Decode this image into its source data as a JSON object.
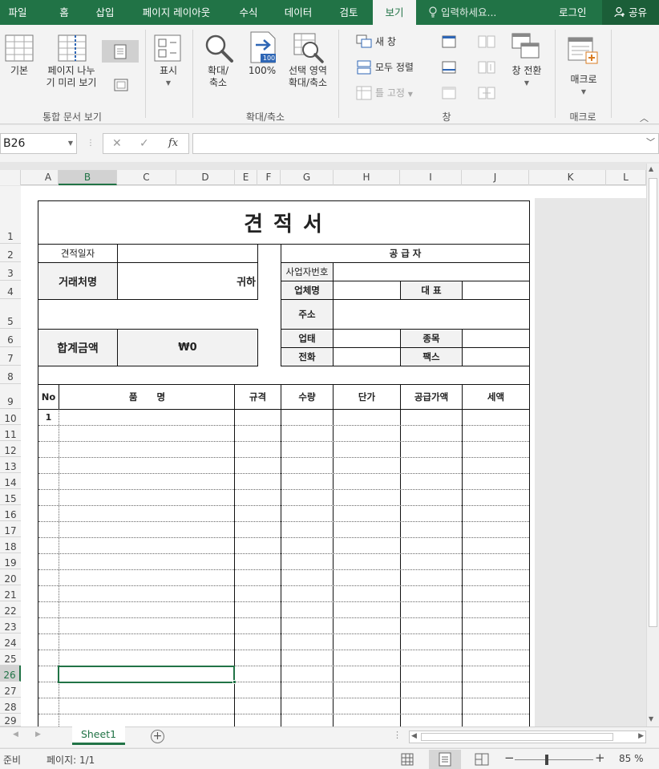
{
  "tabs": [
    "파일",
    "홈",
    "삽입",
    "페이지 레이아웃",
    "수식",
    "데이터",
    "검토",
    "보기"
  ],
  "active_tab": "보기",
  "tell_me_placeholder": "입력하세요...",
  "login": "로그인",
  "share": "공유",
  "ribbon": {
    "workbook_views": {
      "normal": "기본",
      "page_break_1": "페이지 나누",
      "page_break_2": "기 미리 보기",
      "group_label": "통합 문서 보기"
    },
    "show": {
      "label": "표시"
    },
    "zoom": {
      "zoom_1": "확대/",
      "zoom_2": "축소",
      "hundred": "100%",
      "hundred_icon_text": "100",
      "zoom_sel_1": "선택 영역",
      "zoom_sel_2": "확대/축소",
      "group_label": "확대/축소"
    },
    "window": {
      "new_window": "새 창",
      "arrange_all": "모두 정렬",
      "freeze_panes": "틀 고정",
      "switch_windows": "창 전환",
      "group_label": "창"
    },
    "macros": {
      "label": "매크로",
      "group_label": "매크로"
    }
  },
  "formula_bar": {
    "name_box": "B26",
    "fx": "fx",
    "cancel": "✕",
    "enter": "✓",
    "value": ""
  },
  "columns": [
    "A",
    "B",
    "C",
    "D",
    "E",
    "F",
    "G",
    "H",
    "I",
    "J",
    "K",
    "L"
  ],
  "rows": [
    "1",
    "2",
    "3",
    "4",
    "5",
    "6",
    "7",
    "8",
    "9",
    "10",
    "11",
    "12",
    "13",
    "14",
    "15",
    "16",
    "17",
    "18",
    "19",
    "20",
    "21",
    "22",
    "23",
    "24",
    "25",
    "26",
    "27",
    "28",
    "29"
  ],
  "selected_row": "26",
  "quote": {
    "title": "견 적 서",
    "date_label": "견적일자",
    "client_label": "거래처명",
    "honorific": "귀하",
    "total_label": "합계금액",
    "total_value": "₩0",
    "supplier_header": "공 급 자",
    "biz_no": "사업자번호",
    "company": "업체명",
    "ceo": "대 표",
    "address": "주소",
    "biz_type": "업태",
    "biz_item": "종목",
    "phone": "전화",
    "fax": "팩스",
    "items_header": {
      "no": "No",
      "name": "품      명",
      "spec": "규격",
      "qty": "수량",
      "unit_price": "단가",
      "supply_price": "공급가액",
      "tax": "세액"
    },
    "first_no": "1"
  },
  "sheet_tabs": [
    "Sheet1"
  ],
  "status": {
    "ready": "준비",
    "page": "페이지: 1/1",
    "zoom": "85 %"
  }
}
